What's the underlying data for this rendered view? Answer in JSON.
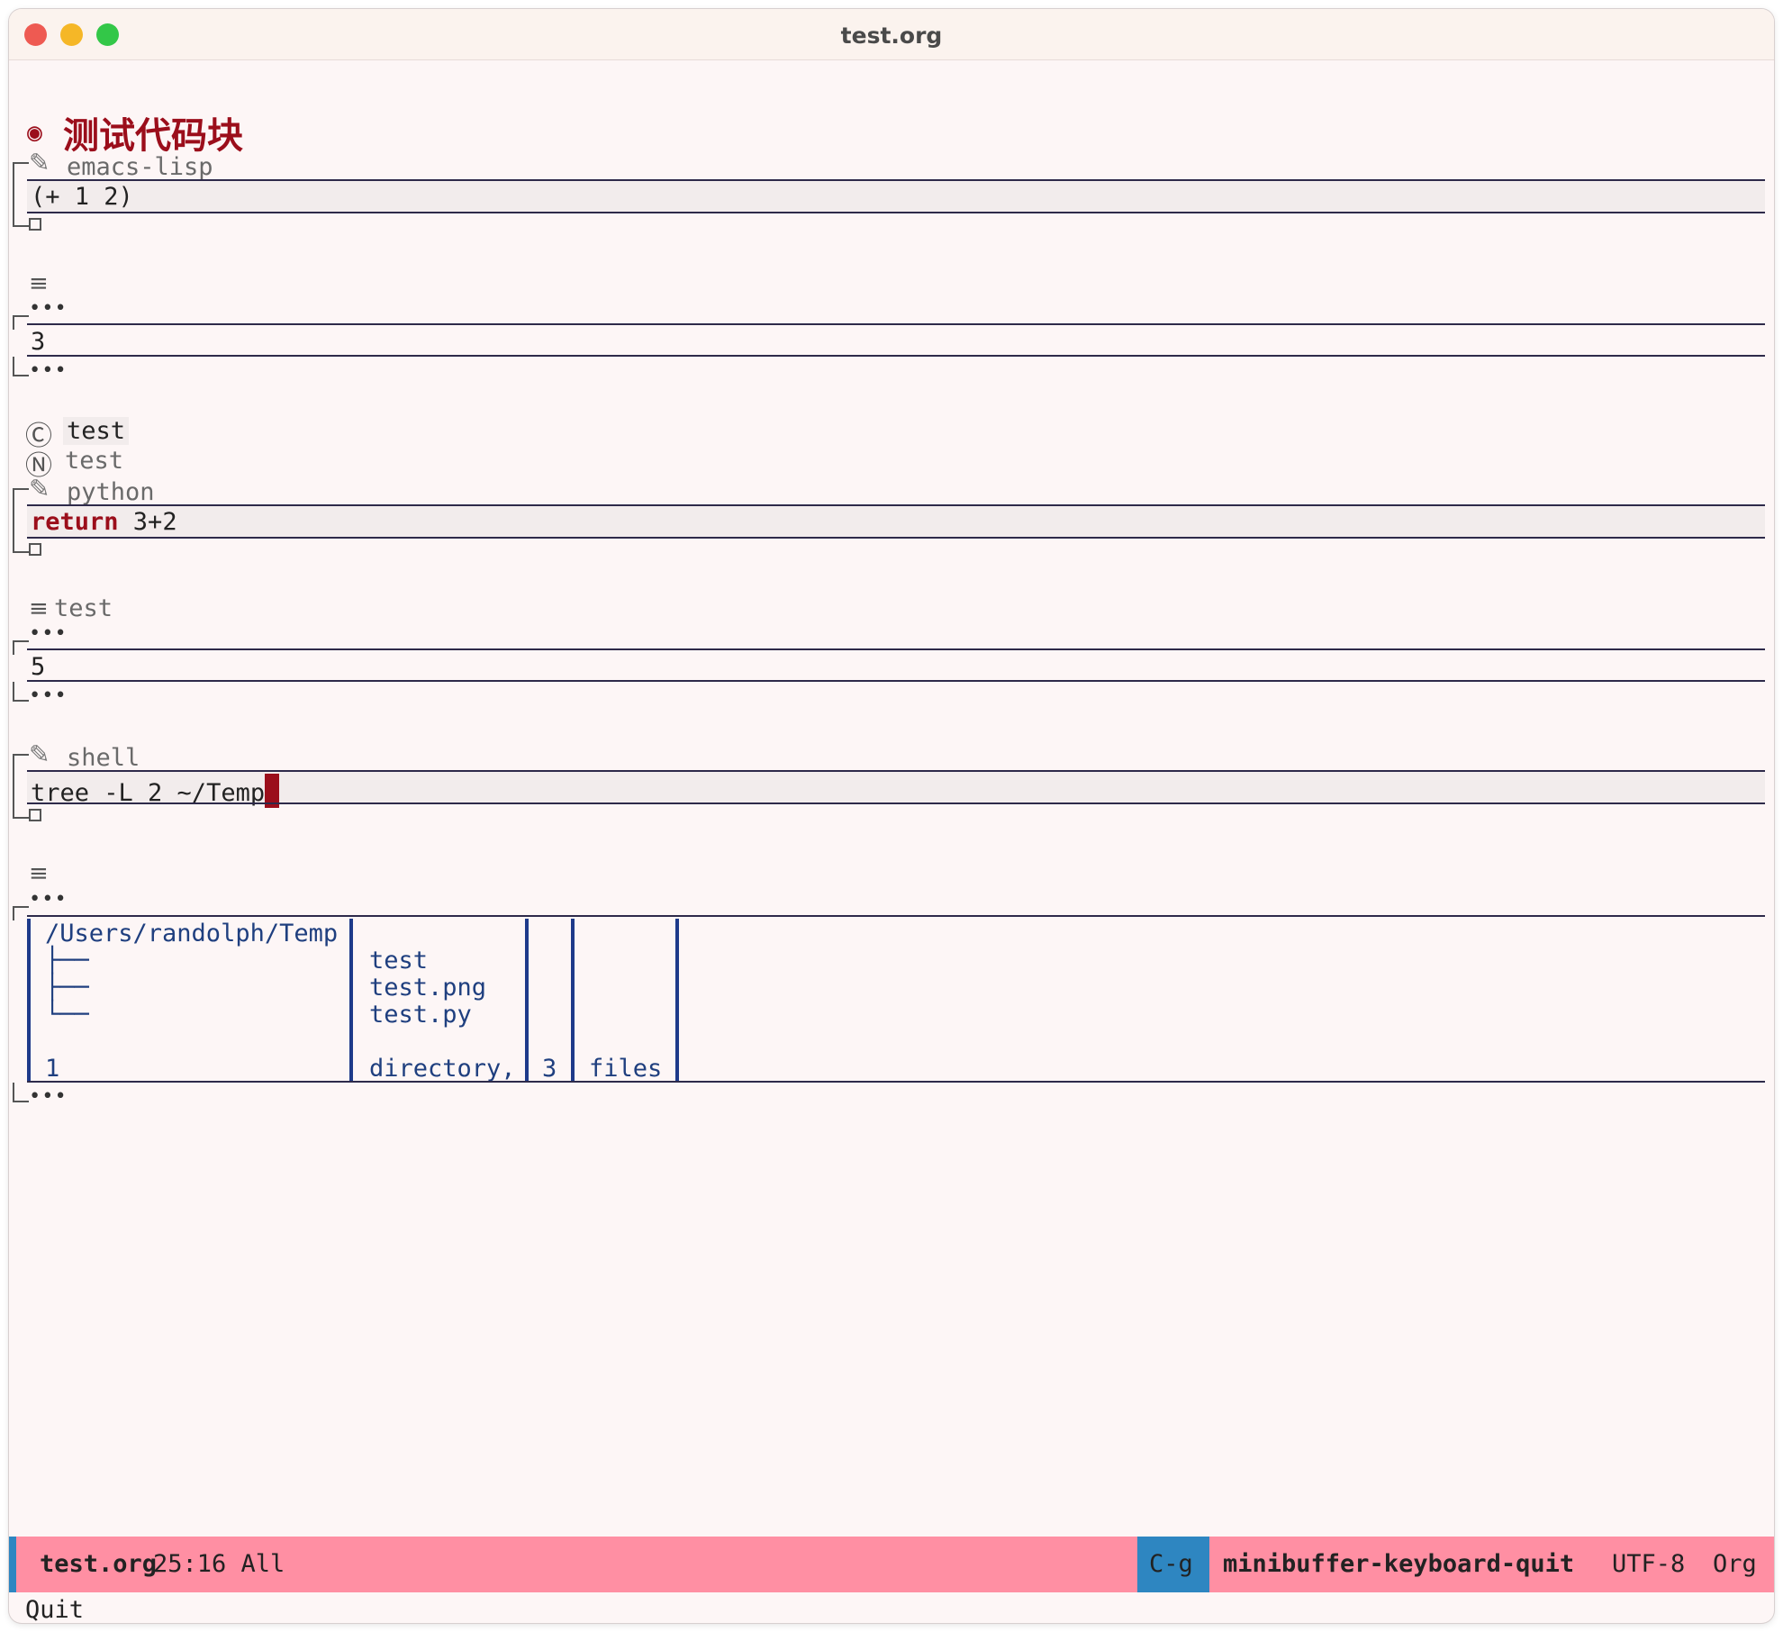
{
  "window": {
    "title": "test.org"
  },
  "heading": {
    "bullet": "◉",
    "text": "测试代码块"
  },
  "blocks": {
    "elisp": {
      "lang": "emacs-lisp",
      "code": "(+ 1 2)",
      "result_label": "",
      "result": "3"
    },
    "tags": {
      "c_icon": "Ⓒ",
      "c_text": "test",
      "n_icon": "Ⓝ",
      "n_text": "test"
    },
    "python": {
      "lang": "python",
      "keyword": "return",
      "code_rest": " 3+2",
      "result_label": "test",
      "result": "5"
    },
    "shell": {
      "lang": "shell",
      "code": "tree -L 2 ~/Temp"
    }
  },
  "shell_result": {
    "col1": {
      "r1": "/Users/randolph/Temp",
      "r2": "├──",
      "r3": "├──",
      "r4": "└──",
      "r6": "1"
    },
    "col2": {
      "r2": "test",
      "r3": "test.png",
      "r4": "test.py",
      "r6": "directory,"
    },
    "col3": {
      "r6": "3"
    },
    "col4": {
      "r6": "files"
    }
  },
  "symbols": {
    "pencil": "✎",
    "menu": "≡",
    "ellipsis": "•••"
  },
  "modeline": {
    "buffer": "test.org",
    "position": "25:16 All",
    "key": "C-g",
    "command": "minibuffer-keyboard-quit",
    "encoding": "UTF-8",
    "mode": "Org"
  },
  "echo_area": "Quit"
}
